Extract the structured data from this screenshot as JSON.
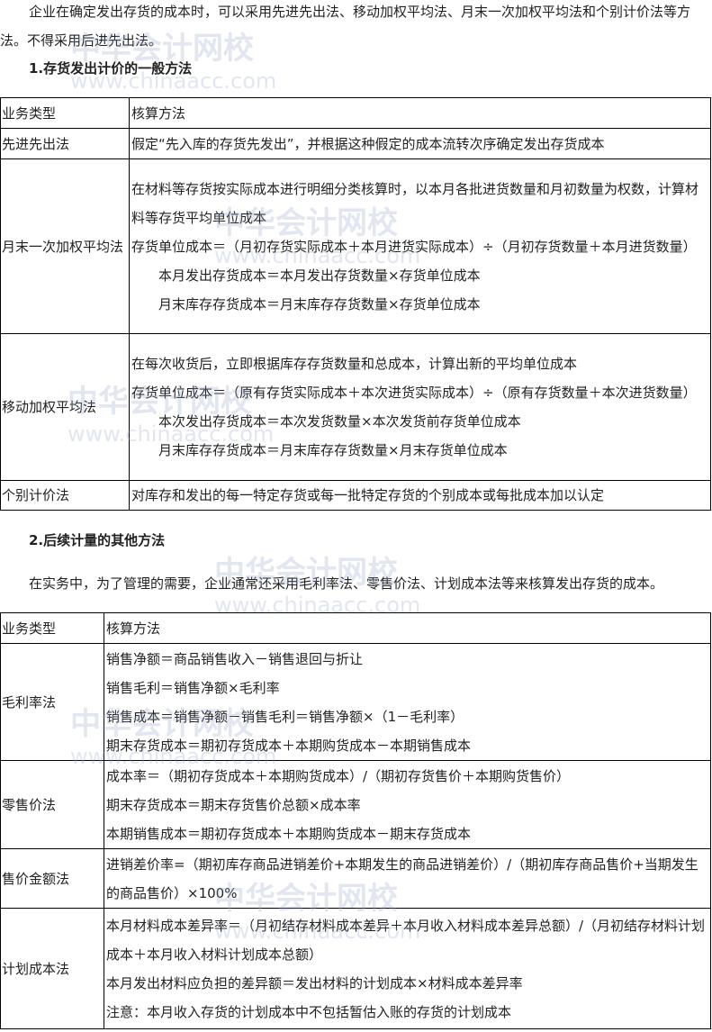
{
  "intro": "企业在确定发出存货的成本时，可以采用先进先出法、移动加权平均法、月末一次加权平均法和个别计价法等方法。不得采用后进先出法。",
  "section1": {
    "heading": "1.存货发出计价的一般方法",
    "headers": [
      "业务类型",
      "核算方法"
    ],
    "rows": [
      {
        "type": "先进先出法",
        "lines": [
          "假定“先入库的存货先发出”，并根据这种假定的成本流转次序确定发出存货成本"
        ]
      },
      {
        "type": "月末一次加权平均法",
        "lines": [
          "在材料等存货按实际成本进行明细分类核算时，以本月各批进货数量和月初数量为权数，计算材料等存货平均单位成本",
          "存货单位成本＝（月初存货实际成本＋本月进货实际成本）÷（月初存货数量＋本月进货数量）",
          "本月发出存货成本＝本月发出存货数量×存货单位成本",
          "月末库存存货成本＝月末库存存货数量×存货单位成本"
        ]
      },
      {
        "type": "移动加权平均法",
        "lines": [
          "在每次收货后，立即根据库存存货数量和总成本，计算出新的平均单位成本",
          "存货单位成本＝（原有存货实际成本＋本次进货实际成本）÷（原有存货数量＋本次进货数量）",
          "本次发出存货成本＝本次发货数量×本次发货前存货单位成本",
          "月末库存存货成本＝月末库存存货数量×月末存货单位成本"
        ]
      },
      {
        "type": "个别计价法",
        "lines": [
          "对库存和发出的每一特定存货或每一批特定存货的个别成本或每批成本加以认定"
        ]
      }
    ]
  },
  "section2": {
    "heading": "2.后续计量的其他方法",
    "intro": "在实务中，为了管理的需要，企业通常还采用毛利率法、零售价法、计划成本法等来核算发出存货的成本。",
    "headers": [
      "业务类型",
      "核算方法"
    ],
    "rows": [
      {
        "type": "毛利率法",
        "lines": [
          "销售净额＝商品销售收入－销售退回与折让",
          "销售毛利＝销售净额×毛利率",
          "销售成本＝销售净额－销售毛利＝销售净额×（1－毛利率）",
          "期末存货成本＝期初存货成本＋本期购货成本－本期销售成本"
        ]
      },
      {
        "type": "零售价法",
        "lines": [
          "成本率＝（期初存货成本＋本期购货成本）/（期初存货售价＋本期购货售价）",
          "期末存货成本＝期末存货售价总额×成本率",
          "本期销售成本＝期初存货成本＋本期购货成本－期末存货成本"
        ]
      },
      {
        "type": "售价金额法",
        "lines": [
          "进销差价率=（期初库存商品进销差价+本期发生的商品进销差价）/（期初库存商品售价+当期发生的商品售价）×100%"
        ]
      },
      {
        "type": "计划成本法",
        "lines": [
          "本月材料成本差异率＝（月初结存材料成本差异＋本月收入材料成本差异总额）/（月初结存材料计划成本＋本月收入材料计划成本总额）",
          "本月发出材料应负担的差异额＝发出材料的计划成本×材料成本差异率",
          "注意：本月收入存货的计划成本中不包括暂估入账的存货的计划成本"
        ]
      }
    ]
  },
  "watermark": {
    "name": "中华会计网校",
    "url": "www.chinaacc.com"
  }
}
